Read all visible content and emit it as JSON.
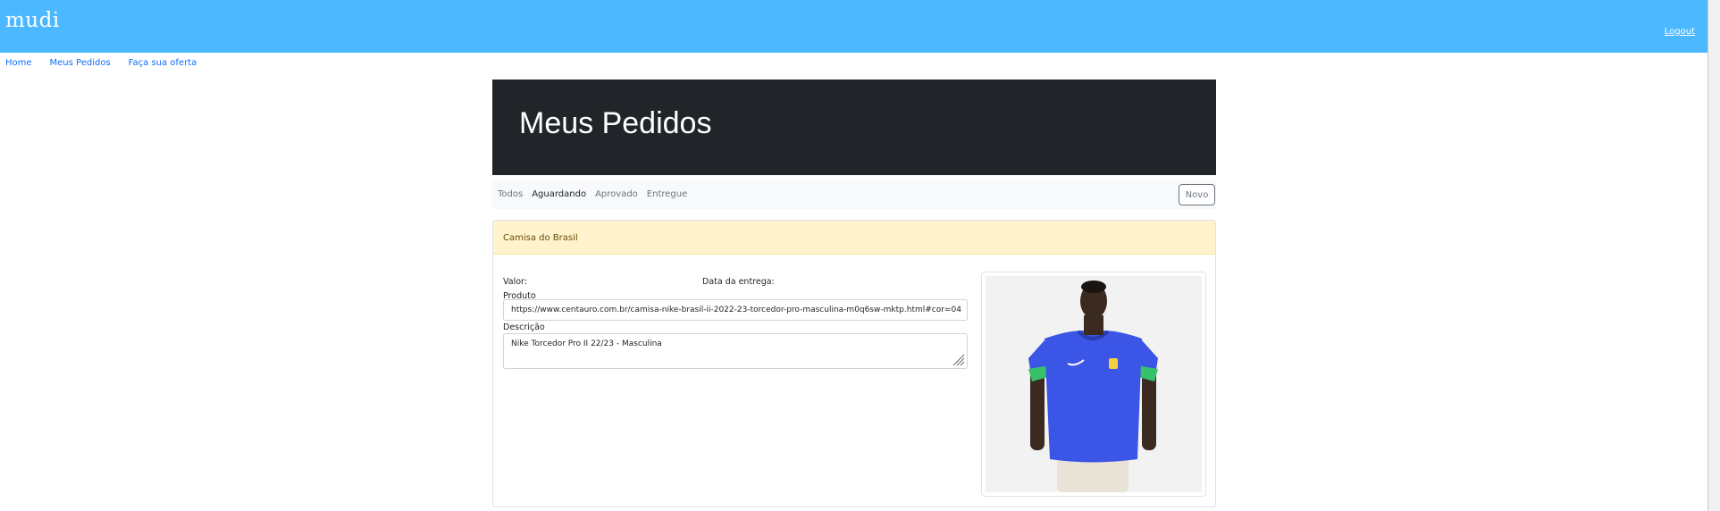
{
  "navbar": {
    "brand": "mudi",
    "logout_label": "Logout"
  },
  "subnav": {
    "items": [
      "Home",
      "Meus Pedidos",
      "Faça sua oferta"
    ]
  },
  "jumbotron": {
    "title": "Meus Pedidos"
  },
  "filters": {
    "items": [
      "Todos",
      "Aguardando",
      "Aprovado",
      "Entregue"
    ],
    "active": "Aguardando",
    "new_label": "Novo"
  },
  "pedido": {
    "title": "Camisa do Brasil",
    "valor_label": "Valor:",
    "data_label": "Data da entrega:",
    "produto_label": "Produto",
    "produto_url": "https://www.centauro.com.br/camisa-nike-brasil-ii-2022-23-torcedor-pro-masculina-m0q6sw-mktp.html#cor=04",
    "descricao_label": "Descrição",
    "descricao": "Nike Torcedor Pro II 22/23 - Masculina",
    "image_icon": "product-photo"
  },
  "colors": {
    "navbar": "#4bb8ff",
    "jumbotron": "#212529",
    "card_header": "#fff3cd",
    "shirt": "#3b55e6"
  }
}
